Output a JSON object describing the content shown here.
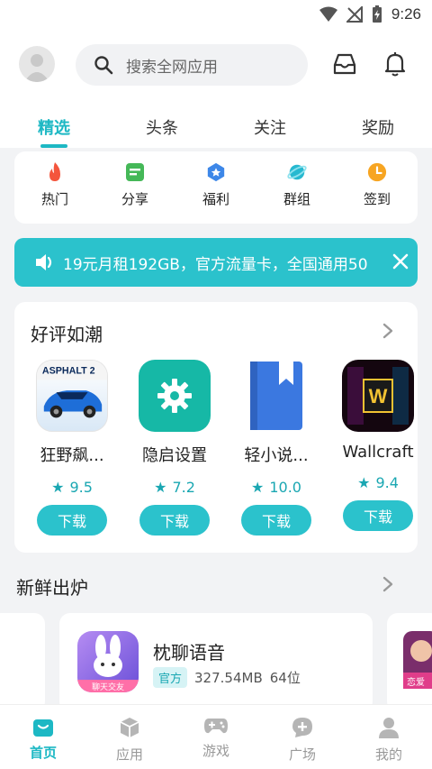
{
  "status": {
    "time": "9:26"
  },
  "header": {
    "search_placeholder": "搜索全网应用"
  },
  "tabs": [
    {
      "label": "精选",
      "active": true
    },
    {
      "label": "头条"
    },
    {
      "label": "关注"
    },
    {
      "label": "奖励"
    }
  ],
  "quick": [
    {
      "label": "热门",
      "icon": "flame-icon",
      "color": "#f4553c"
    },
    {
      "label": "分享",
      "icon": "share-doc-icon",
      "color": "#45b858"
    },
    {
      "label": "福利",
      "icon": "gift-badge-icon",
      "color": "#3d87e8"
    },
    {
      "label": "群组",
      "icon": "planet-icon",
      "color": "#27b9d0"
    },
    {
      "label": "签到",
      "icon": "clock-icon",
      "color": "#f7a522"
    }
  ],
  "banner": {
    "text": "19元月租192GB，官方流量卡，全国通用50"
  },
  "section_good": {
    "title": "好评如潮",
    "apps": [
      {
        "name": "狂野飙...",
        "rating": "9.5",
        "button": "下载",
        "icon": "asphalt-car-icon",
        "logo_text": "ASPHALT 2"
      },
      {
        "name": "隐启设置",
        "rating": "7.2",
        "button": "下载",
        "icon": "gear-icon"
      },
      {
        "name": "轻小说...",
        "rating": "10.0",
        "button": "下载",
        "icon": "book-icon"
      },
      {
        "name": "Wallcraft",
        "rating": "9.4",
        "button": "下载",
        "icon": "wallcraft-icon",
        "logo_text": "W"
      }
    ]
  },
  "section_fresh": {
    "title": "新鲜出炉",
    "featured": {
      "name": "枕聊语音",
      "badge": "官方",
      "size": "327.54MB",
      "arch": "64位",
      "icon_caption": "聊天交友"
    },
    "peek_caption": "恋爱"
  },
  "bottomnav": [
    {
      "label": "首页",
      "icon": "home-bag-icon",
      "active": true
    },
    {
      "label": "应用",
      "icon": "box-icon"
    },
    {
      "label": "游戏",
      "icon": "gamepad-icon"
    },
    {
      "label": "广场",
      "icon": "chat-plus-icon"
    },
    {
      "label": "我的",
      "icon": "user-icon"
    }
  ],
  "colors": {
    "accent": "#1db8c4",
    "banner": "#2bc2cc"
  }
}
